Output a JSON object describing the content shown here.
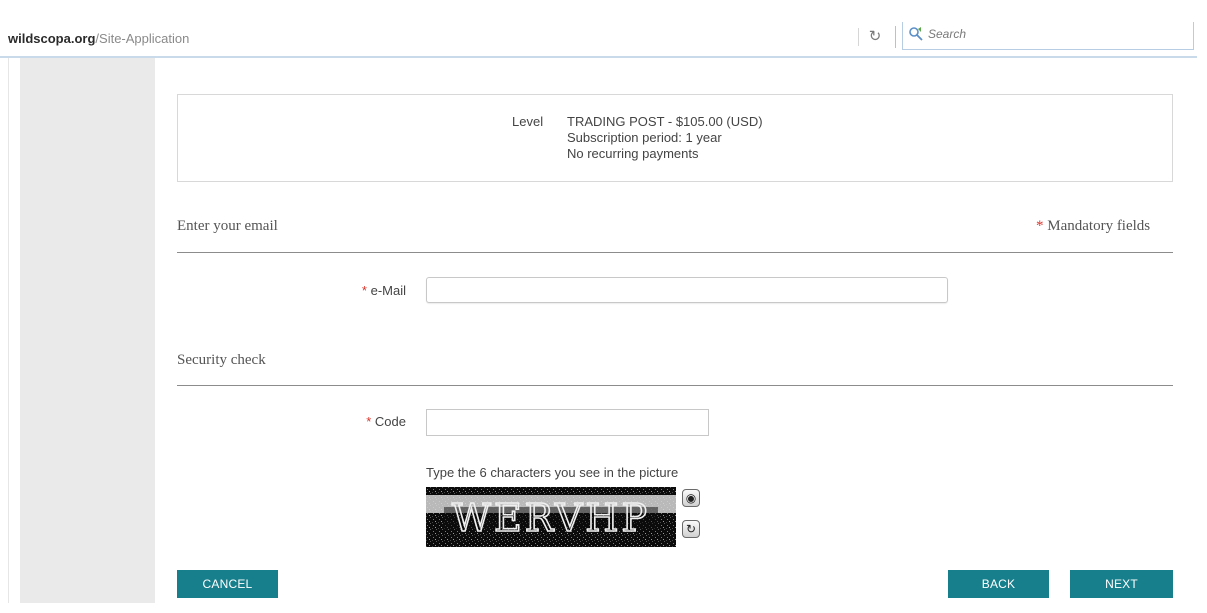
{
  "browser": {
    "url_domain": "wildscopa.org",
    "url_path": "/Site-Application",
    "reload_icon": "reload-icon",
    "search_placeholder": "Search",
    "search_icon": "search-icon"
  },
  "membership": {
    "level_label": "Level",
    "level_name": "TRADING POST - $105.00 (USD)",
    "subscription_period": "Subscription period: 1 year",
    "recurring": "No recurring payments"
  },
  "email_section": {
    "title": "Enter your email",
    "mandatory_asterisk": "*",
    "mandatory_note": "Mandatory fields",
    "email_asterisk": "*",
    "email_label": "e-Mail",
    "email_value": ""
  },
  "security_section": {
    "title": "Security check",
    "code_asterisk": "*",
    "code_label": "Code",
    "code_value": "",
    "captcha_hint": "Type the 6 characters you see in the picture",
    "captcha_text": "WERVHP",
    "audio_icon": "speaker-icon",
    "refresh_icon": "refresh-icon"
  },
  "buttons": {
    "cancel": "CANCEL",
    "back": "BACK",
    "next": "NEXT"
  },
  "colors": {
    "button": "#177f8c",
    "asterisk": "#d9342b",
    "gutter": "#eaeaea"
  }
}
